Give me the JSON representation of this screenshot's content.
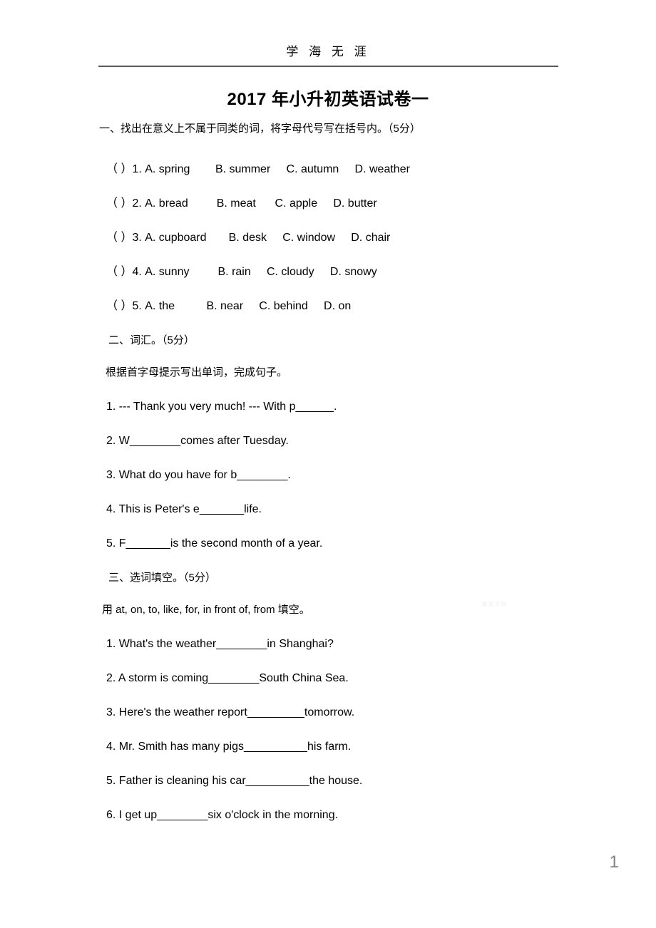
{
  "header": {
    "running_head": "学 海 无  涯",
    "title": "2017 年小升初英语试卷一"
  },
  "page_number": "1",
  "watermark": "精品文档",
  "sections": [
    {
      "heading": "一、找出在意义上不属于同类的词，将字母代号写在括号内。（5分）",
      "instruction": null,
      "items": [
        "（ ）1. A. spring        B. summer     C. autumn     D. weather",
        "（ ）2. A. bread         B. meat      C. apple     D. butter",
        "（ ）3. A. cupboard       B. desk     C. window     D. chair",
        "（ ）4. A. sunny         B. rain     C. cloudy     D. snowy",
        "（ ）5. A. the          B. near     C. behind     D. on"
      ]
    },
    {
      "heading": "二、词汇。（5分）",
      "instruction": "根据首字母提示写出单词，完成句子。",
      "items": [
        "1. --- Thank you very much! --- With p______.",
        "2. W________comes after Tuesday.",
        "3. What do you have for b________.",
        "4. This is Peter's e_______life.",
        "5. F_______is the second month of a year."
      ]
    },
    {
      "heading": "三、选词填空。（5分）",
      "instruction": "用 at, on, to, like, for, in front of, from 填空。",
      "items": [
        "1. What's the weather________in Shanghai?",
        "2. A storm is coming________South China Sea.",
        "3. Here's the weather report_________tomorrow.",
        "4. Mr. Smith has many pigs__________his farm.",
        "5. Father is cleaning his car__________the house.",
        "6. I get up________six o'clock in the morning."
      ]
    }
  ]
}
